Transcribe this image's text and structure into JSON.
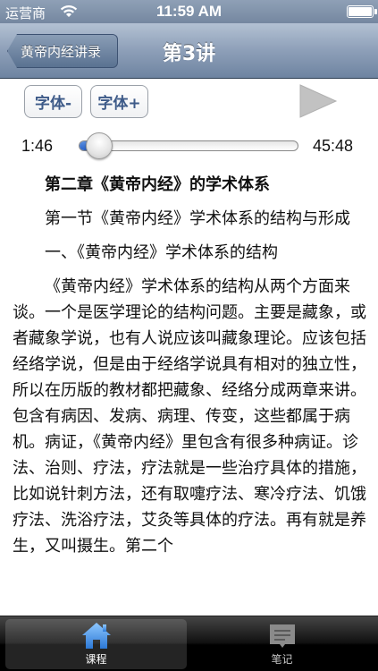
{
  "status_bar": {
    "carrier": "运营商",
    "time": "11:59 AM"
  },
  "nav": {
    "back_label": "黄帝内经讲录",
    "title": "第3讲"
  },
  "controls": {
    "font_decrease": "字体-",
    "font_increase": "字体+",
    "play_icon": "play-icon"
  },
  "player": {
    "current_time": "1:46",
    "total_time": "45:48",
    "progress": 0.039
  },
  "article": {
    "chapter": "第二章《黄帝内经》的学术体系",
    "section": "第一节《黄帝内经》学术体系的结构与形成",
    "subsection": "一、《黄帝内经》学术体系的结构",
    "body": "《黄帝内经》学术体系的结构从两个方面来谈。一个是医学理论的结构问题。主要是藏象，或者藏象学说，也有人说应该叫藏象理论。应该包括经络学说，但是由于经络学说具有相对的独立性，所以在历版的教材都把藏象、经络分成两章来讲。包含有病因、发病、病理、传变，这些都属于病机。病证，《黄帝内经》里包含有很多种病证。诊法、治则、疗法，疗法就是一些治疗具体的措施，比如说针刺方法，还有取嚏疗法、寒冷疗法、饥饿疗法、洗浴疗法，艾灸等具体的疗法。再有就是养生，又叫摄生。第二个"
  },
  "tabs": [
    {
      "label": "课程",
      "icon": "home-icon",
      "selected": true
    },
    {
      "label": "笔记",
      "icon": "notebook-icon",
      "selected": false
    }
  ],
  "colors": {
    "nav_bar": "#8d9fb8",
    "button_text": "#3d5a88",
    "slider_fill": "#2a62c8",
    "tab_icon_selected": "#3a8ede"
  }
}
